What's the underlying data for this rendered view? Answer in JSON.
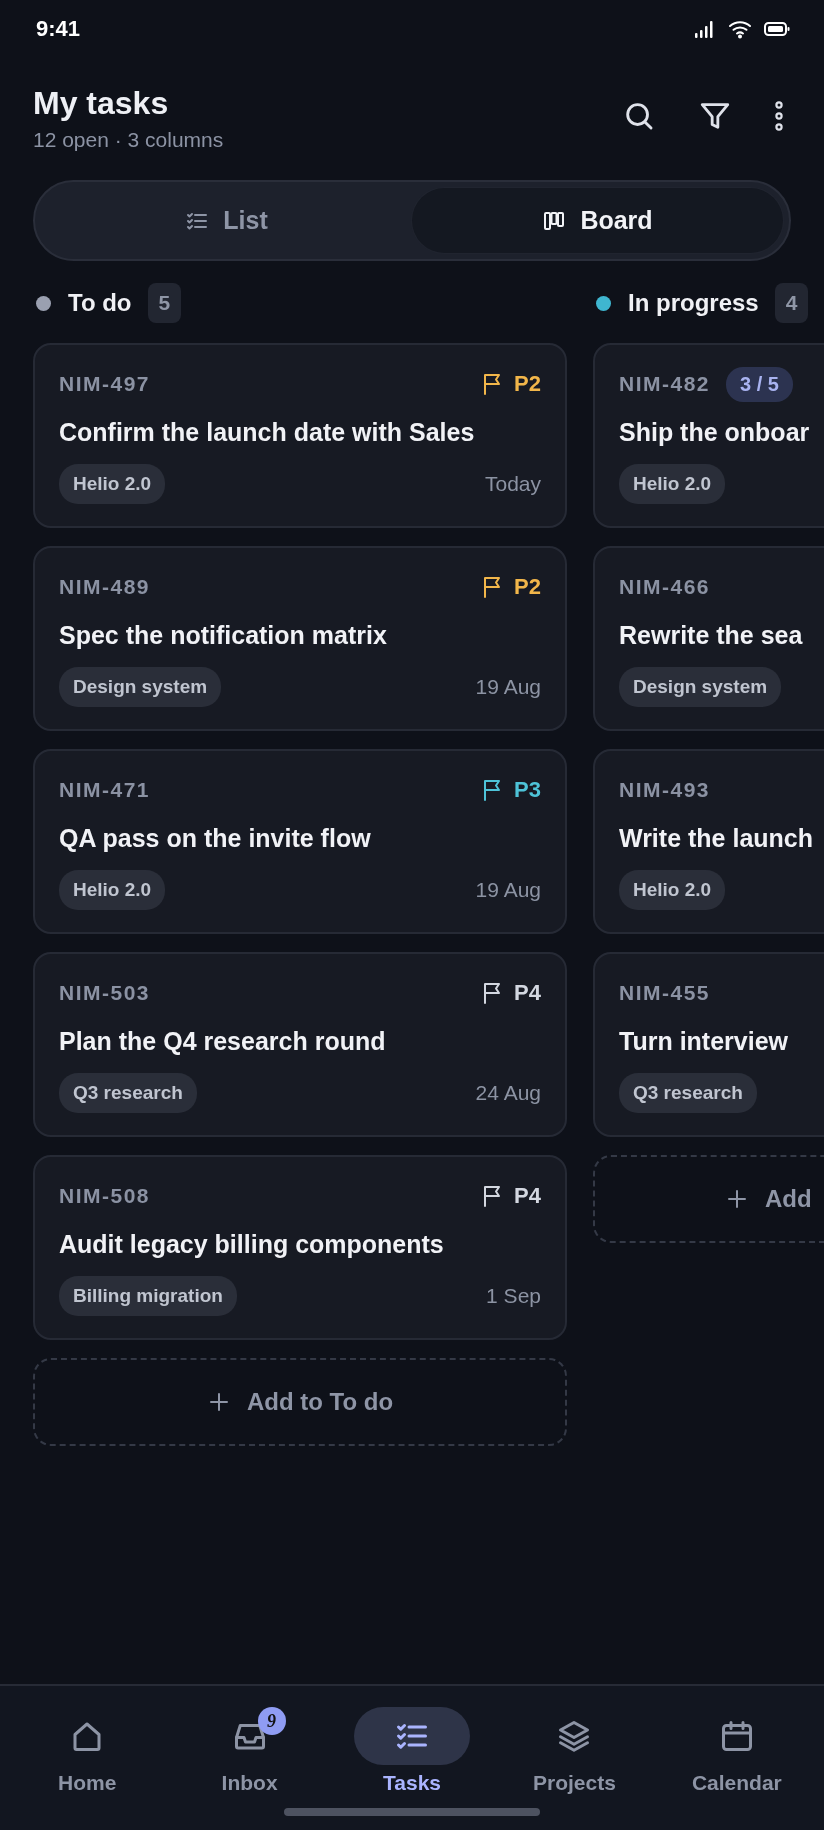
{
  "status_bar": {
    "time": "9:41"
  },
  "header": {
    "title": "My tasks",
    "subtitle": "12 open · 3 columns"
  },
  "view_switch": [
    {
      "label": "List",
      "kind": "list",
      "selected": false
    },
    {
      "label": "Board",
      "kind": "board",
      "selected": true
    }
  ],
  "columns": [
    {
      "title": "To do",
      "count": "5",
      "color": "#9aa0b0",
      "add_label": "Add to To do",
      "cards": [
        {
          "id": "NIM-497",
          "priority": {
            "label": "P2",
            "color": "#f2b64a"
          },
          "title": "Confirm the launch date with Sales",
          "tag": "Helio 2.0",
          "due": "Today"
        },
        {
          "id": "NIM-489",
          "priority": {
            "label": "P2",
            "color": "#f2b64a"
          },
          "title": "Spec the notification matrix",
          "tag": "Design system",
          "due": "19 Aug"
        },
        {
          "id": "NIM-471",
          "priority": {
            "label": "P3",
            "color": "#4ec3d8"
          },
          "title": "QA pass on the invite flow",
          "tag": "Helio 2.0",
          "due": "19 Aug"
        },
        {
          "id": "NIM-503",
          "priority": {
            "label": "P4",
            "color": "#d3d7e0"
          },
          "title": "Plan the Q4 research round",
          "tag": "Q3 research",
          "due": "24 Aug"
        },
        {
          "id": "NIM-508",
          "priority": {
            "label": "P4",
            "color": "#d3d7e0"
          },
          "title": "Audit legacy billing components",
          "tag": "Billing migration",
          "due": "1 Sep"
        }
      ]
    },
    {
      "title": "In progress",
      "count": "4",
      "color": "#3fb6d0",
      "add_label": "Add",
      "cards": [
        {
          "id": "NIM-482",
          "progress": "3 / 5",
          "title": "Ship the onboar",
          "tag": "Helio 2.0"
        },
        {
          "id": "NIM-466",
          "title": "Rewrite the sea",
          "tag": "Design system"
        },
        {
          "id": "NIM-493",
          "title": "Write the launch",
          "tag": "Helio 2.0"
        },
        {
          "id": "NIM-455",
          "title": "Turn interview",
          "tag": "Q3 research"
        }
      ]
    }
  ],
  "bottom_nav": [
    {
      "label": "Home",
      "kind": "home",
      "selected": false
    },
    {
      "label": "Inbox",
      "kind": "inbox",
      "selected": false,
      "badge": "9"
    },
    {
      "label": "Tasks",
      "kind": "tasks",
      "selected": true
    },
    {
      "label": "Projects",
      "kind": "layers",
      "selected": false
    },
    {
      "label": "Calendar",
      "kind": "calendar",
      "selected": false
    }
  ]
}
